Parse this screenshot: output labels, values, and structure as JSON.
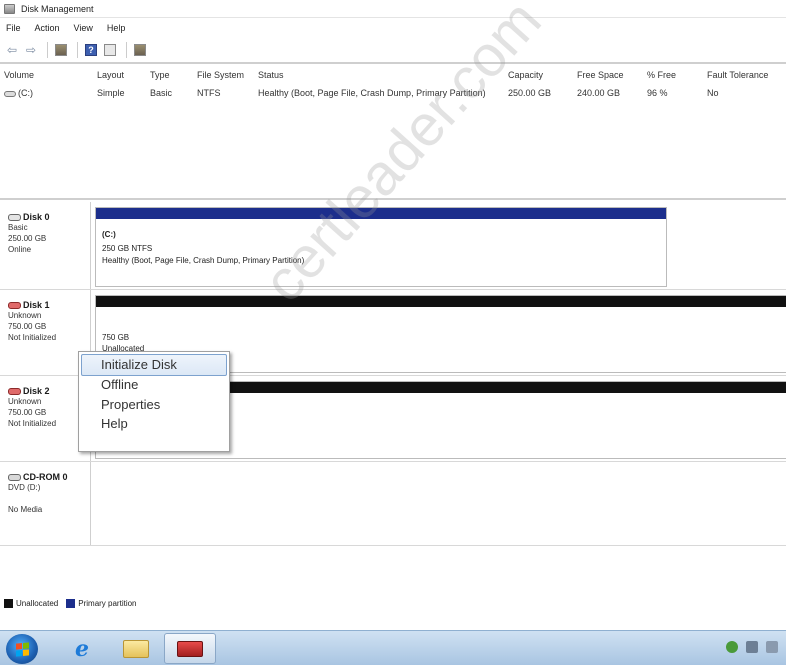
{
  "window": {
    "title": "Disk Management"
  },
  "menubar": {
    "items": [
      "File",
      "Action",
      "View",
      "Help"
    ]
  },
  "volume_list": {
    "columns": [
      "Volume",
      "Layout",
      "Type",
      "File System",
      "Status",
      "Capacity",
      "Free Space",
      "% Free",
      "Fault Tolerance"
    ],
    "rows": [
      {
        "volume": "(C:)",
        "layout": "Simple",
        "type": "Basic",
        "file_system": "NTFS",
        "status": "Healthy (Boot, Page File, Crash Dump, Primary Partition)",
        "capacity": "250.00 GB",
        "free_space": "240.00 GB",
        "percent_free": "96 %",
        "fault_tolerance": "No"
      }
    ]
  },
  "disks": [
    {
      "name": "Disk 0",
      "line1": "Basic",
      "line2": "250.00 GB",
      "line3": "Online",
      "partition": {
        "title": "(C:)",
        "line1": "250 GB NTFS",
        "line2": "Healthy (Boot, Page File, Crash Dump, Primary Partition)"
      }
    },
    {
      "name": "Disk 1",
      "line1": "Unknown",
      "line2": "750.00 GB",
      "line3": "Not Initialized",
      "partition": {
        "line1": "750 GB",
        "line2": "Unallocated"
      }
    },
    {
      "name": "Disk 2",
      "line1": "Unknown",
      "line2": "750.00 GB",
      "line3": "Not Initialized"
    },
    {
      "name": "CD-ROM 0",
      "line1": "DVD (D:)",
      "line2": "",
      "line3": "No Media"
    }
  ],
  "context_menu": {
    "items": [
      "Initialize Disk",
      "Offline",
      "Properties",
      "Help"
    ]
  },
  "legend": [
    {
      "label": "Unallocated",
      "color": "#111111"
    },
    {
      "label": "Primary partition",
      "color": "#1c2e8c"
    }
  ],
  "watermark": "certleader.com",
  "colors": {
    "primary_partition": "#1c2e8c",
    "unallocated": "#111111",
    "taskbar": "#b9d1ea"
  },
  "taskbar": {
    "apps": [
      "start-orb",
      "internet-explorer",
      "windows-explorer",
      "computer-management"
    ]
  }
}
